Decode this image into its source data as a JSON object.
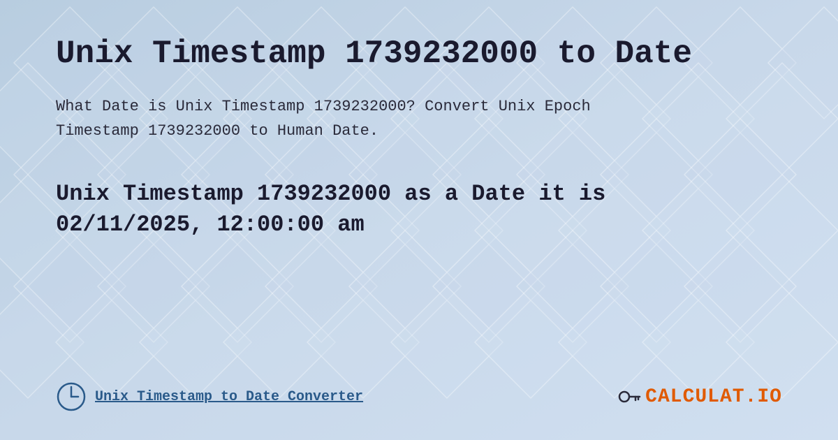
{
  "page": {
    "title": "Unix Timestamp 1739232000 to Date",
    "description_line1": "What Date is Unix Timestamp 1739232000? Convert Unix Epoch",
    "description_line2": "Timestamp 1739232000 to Human Date.",
    "result_line1": "Unix Timestamp 1739232000 as a Date it is",
    "result_line2": "02/11/2025, 12:00:00 am",
    "footer_label": "Unix Timestamp to Date Converter",
    "logo_text": "CALCULAT.IO"
  },
  "colors": {
    "background": "#c8d8e8",
    "text_dark": "#1a1a2e",
    "text_blue": "#2a5a8a",
    "accent": "#e05a00"
  }
}
